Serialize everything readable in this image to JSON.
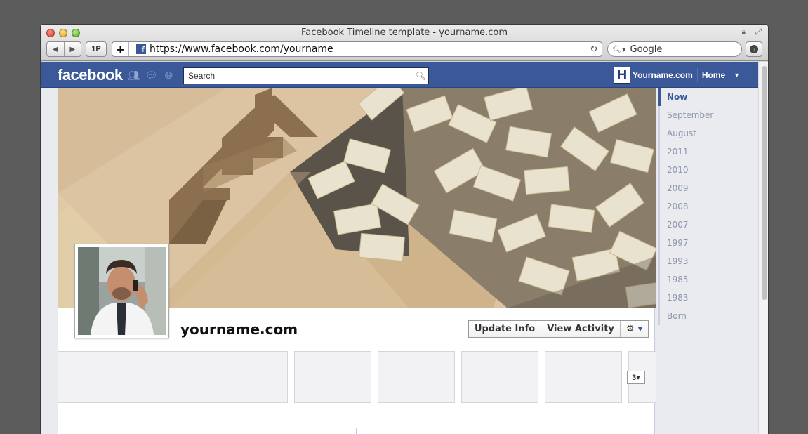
{
  "window": {
    "title": "Facebook Timeline template - yourname.com",
    "url": "https://www.facebook.com/yourname",
    "search_engine": "Google",
    "pw_label": "1P",
    "new_tab_symbol": "+"
  },
  "facebook": {
    "logo": "facebook",
    "search_placeholder": "Search",
    "user_initial": "H",
    "user_name": "Yourname.com",
    "home_label": "Home",
    "brand_color": "#3b5998"
  },
  "profile": {
    "name": "yourname.com",
    "update_info_label": "Update Info",
    "view_activity_label": "View Activity",
    "more_tabs_count": "3"
  },
  "scrubber": {
    "items": [
      "Now",
      "September",
      "August",
      "2011",
      "2010",
      "2009",
      "2008",
      "2007",
      "1997",
      "1993",
      "1985",
      "1983",
      "Born"
    ]
  }
}
